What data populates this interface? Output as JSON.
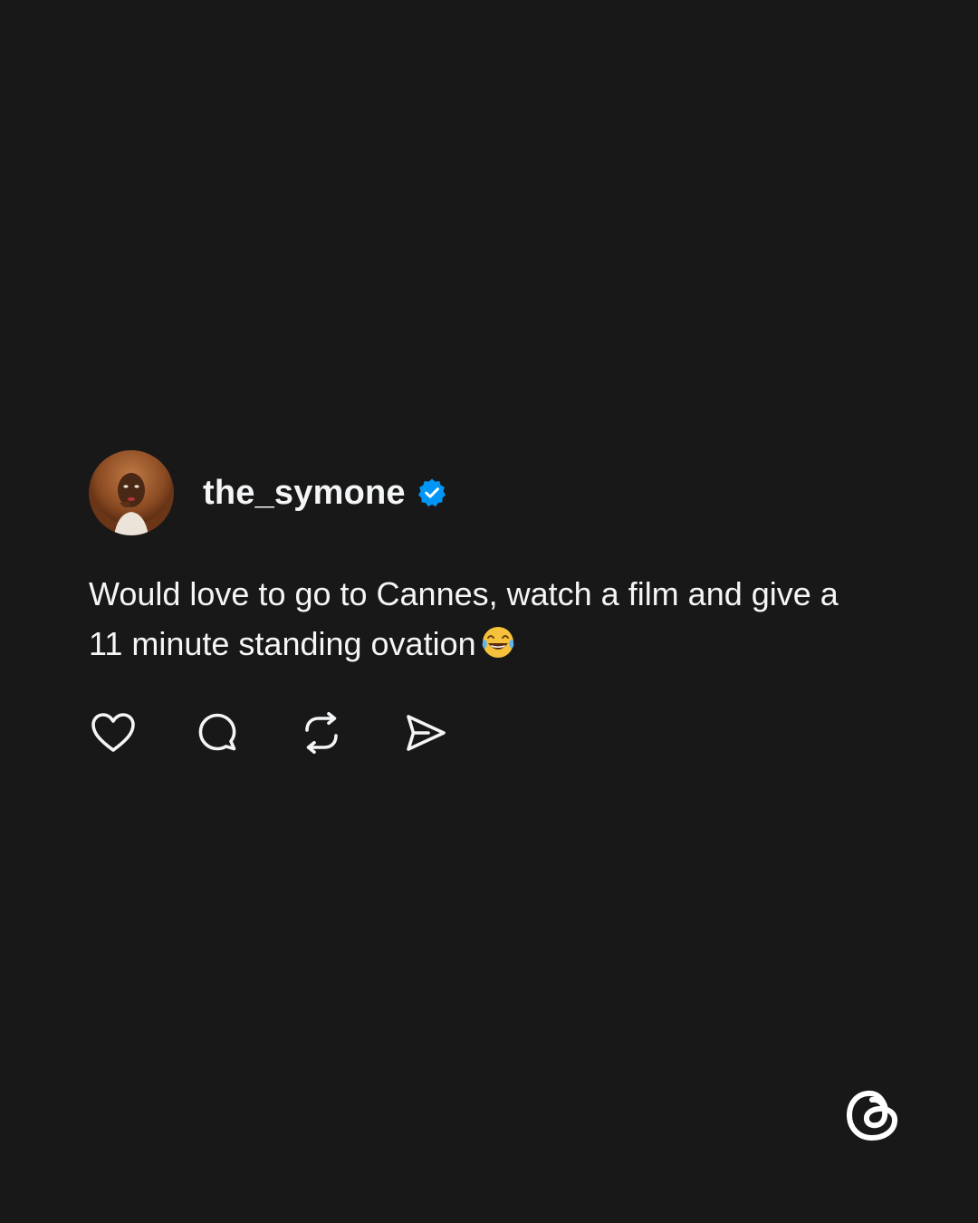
{
  "post": {
    "author": {
      "username": "the_symone",
      "verified": true,
      "avatar_icon": "profile-photo",
      "verified_icon": "verified-badge-icon"
    },
    "text": "Would love to go to Cannes, watch a film and give a 11 minute standing ovation",
    "emoji": "face-with-tears-of-joy",
    "actions": [
      {
        "icon": "heart-icon"
      },
      {
        "icon": "comment-icon"
      },
      {
        "icon": "repost-icon"
      },
      {
        "icon": "share-icon"
      }
    ]
  },
  "branding": {
    "logo_icon": "threads-logo"
  },
  "colors": {
    "background": "#181818",
    "text": "#f3f5f7",
    "verified": "#0095f6",
    "icon_stroke": "#f3f5f7"
  }
}
